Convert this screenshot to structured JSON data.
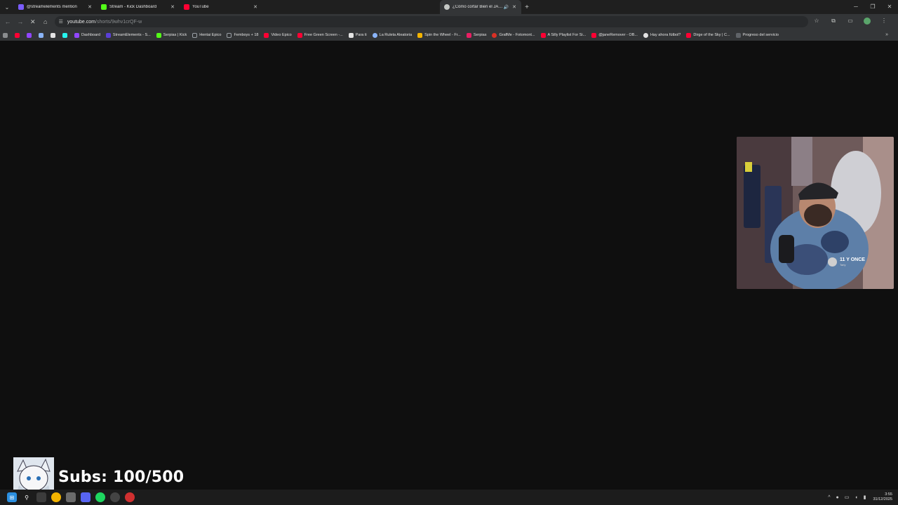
{
  "tabs": [
    {
      "title": "@streamelements mention",
      "favicon_color": "#7b5cff",
      "active": false
    },
    {
      "title": "Stream - Kick Dashboard",
      "favicon_color": "#53fc18",
      "active": false
    },
    {
      "title": "YouTube",
      "favicon_color": "#ff0033",
      "active": false
    },
    {
      "title": "¿Cómo cortar Bien el JAMÓN",
      "favicon_color": "#c4c7c5",
      "active": true
    }
  ],
  "omnibox": {
    "domain": "youtube.com",
    "path": "/shorts/9whv1crQF-w"
  },
  "bookmarks": [
    {
      "label": "Dashboard",
      "color": "#9146ff"
    },
    {
      "label": "StreamElements - S...",
      "color": "#5a3fd6"
    },
    {
      "label": "Serpias | Kick",
      "color": "#53fc18"
    },
    {
      "label": "Hentai Epico",
      "color": "#9aa0a6"
    },
    {
      "label": "Femboys + 18",
      "color": "#9aa0a6"
    },
    {
      "label": "Video Epico",
      "color": "#ff0033"
    },
    {
      "label": "Free Green Screen -...",
      "color": "#ff0033"
    },
    {
      "label": "Para ti",
      "color": "#e3e3e3"
    },
    {
      "label": "La Ruleta Aleatoria",
      "color": "#8ab4f8"
    },
    {
      "label": "Spin the Wheel - Fr...",
      "color": "#f4b400"
    },
    {
      "label": "Serpias",
      "color": "#e91e63"
    },
    {
      "label": "GrafMe - Fotomont...",
      "color": "#d93025"
    },
    {
      "label": "A Silly Playlist For Si...",
      "color": "#ff0033"
    },
    {
      "label": "@janeRemover - OB...",
      "color": "#ff0033"
    },
    {
      "label": "Hay ahora fútbol?",
      "color": "#e3e3e3"
    },
    {
      "label": "Dirge of the Sky | C...",
      "color": "#ff0033"
    },
    {
      "label": "Progreso del servicio",
      "color": "#5f6368"
    }
  ],
  "webcam": {
    "badge_title": "11 Y ONCE",
    "badge_sub": "Tariy"
  },
  "subs": {
    "label": "Subs: 100/500",
    "current": 100,
    "goal": 500
  },
  "clock": {
    "time": "3:55",
    "date": "31/12/2025"
  },
  "icons": [
    "tab-search-icon",
    "back-icon",
    "forward-icon",
    "reload-icon",
    "home-icon",
    "star-icon",
    "extensions-icon",
    "cast-icon",
    "profile-icon",
    "minimize-icon",
    "maximize-icon",
    "close-window-icon"
  ]
}
